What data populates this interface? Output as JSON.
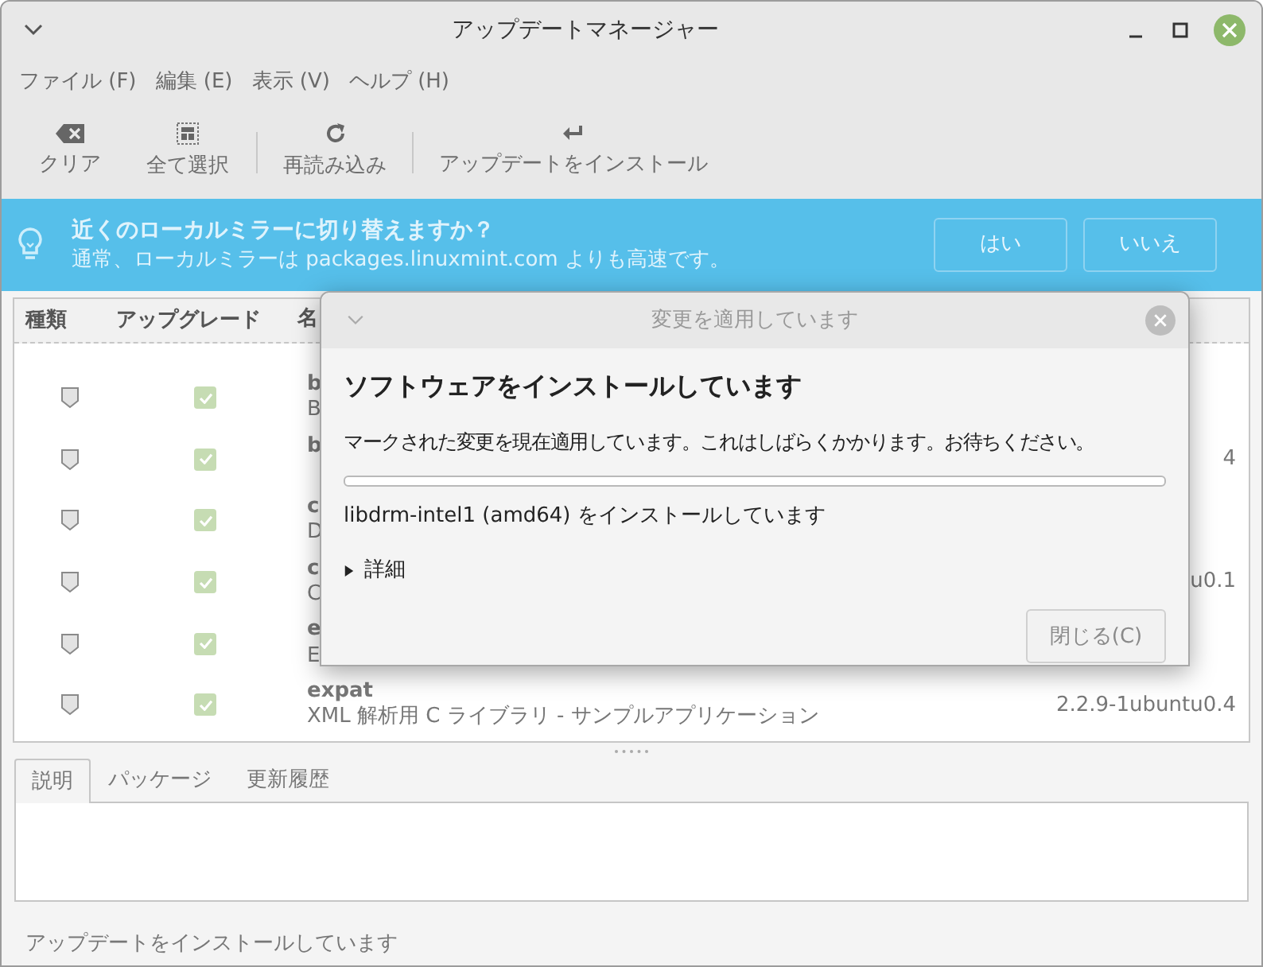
{
  "window": {
    "title": "アップデートマネージャー"
  },
  "menu": [
    "ファイル (F)",
    "編集 (E)",
    "表示 (V)",
    "ヘルプ (H)"
  ],
  "toolbar": [
    {
      "label": "クリア"
    },
    {
      "label": "全て選択"
    },
    {
      "label": "再読み込み"
    },
    {
      "label": "アップデートをインストール"
    }
  ],
  "infobar": {
    "title": "近くのローカルミラーに切り替えますか？",
    "message": "通常、ローカルミラーは packages.linuxmint.com よりも高速です。",
    "buttons": [
      "はい",
      "いいえ"
    ]
  },
  "table": {
    "columns": [
      "種類",
      "アップグレード",
      "名"
    ],
    "rows": [
      {
        "checked": true,
        "name": "b",
        "description": "B"
      },
      {
        "checked": true,
        "name": "b",
        "version": "4"
      },
      {
        "checked": true,
        "name": "c",
        "description": "D"
      },
      {
        "checked": true,
        "name": "c",
        "description": "C",
        "version": "u0.1"
      },
      {
        "checked": true,
        "name": "e",
        "description": "E"
      },
      {
        "checked": true,
        "name": "expat",
        "description": "XML 解析用 C ライブラリ - サンプルアプリケーション",
        "version": "2.2.9-1ubuntu0.4"
      }
    ]
  },
  "tabs": [
    {
      "label": "説明",
      "selected": true
    },
    {
      "label": "パッケージ",
      "selected": false
    },
    {
      "label": "更新履歴",
      "selected": false
    }
  ],
  "status_bar": "アップデートをインストールしています",
  "dialog": {
    "title": "変更を適用しています",
    "heading": "ソフトウェアをインストールしています",
    "message": "マークされた変更を現在適用しています。これはしばらくかかります。お待ちください。",
    "level": 0,
    "current": "libdrm-intel1 (amd64) をインストールしています",
    "details": {
      "label": "詳細",
      "expanded": false
    },
    "close_button": {
      "label": "閉じる(C)",
      "disabled": true
    }
  }
}
